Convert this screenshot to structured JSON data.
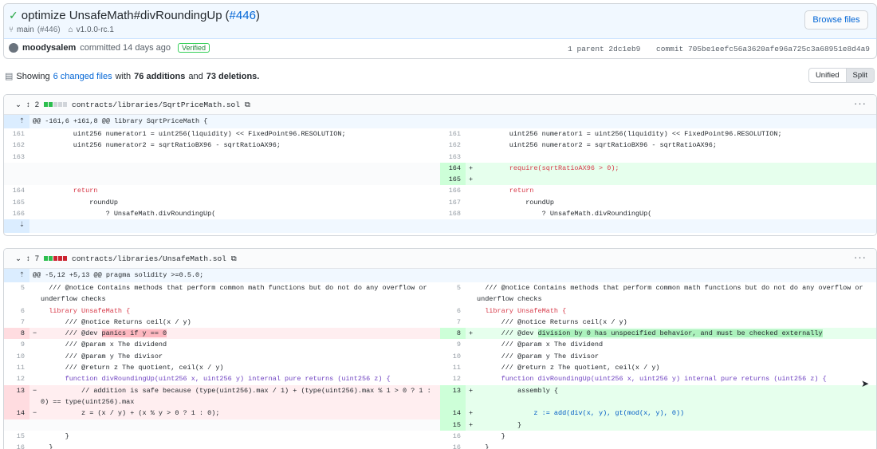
{
  "commit": {
    "title": "optimize UnsafeMath#divRoundingUp",
    "pr": "#446",
    "branch": "main",
    "branch_pr": "(#446)",
    "tag": "v1.0.0-rc.1",
    "browse_label": "Browse files",
    "author": "moodysalem",
    "committed": "committed 14 days ago",
    "verified": "Verified",
    "parent": "1 parent 2dc1eb9",
    "sha": "commit 705be1eefc56a3620afe96a725c3a68951e8d4a9"
  },
  "summary": {
    "prefix": "Showing",
    "files_link": "6 changed files",
    "middle": "with",
    "additions": "76 additions",
    "and": "and",
    "deletions": "73 deletions."
  },
  "view_toggle": {
    "unified": "Unified",
    "split": "Split"
  },
  "files": [
    {
      "count": "2",
      "path": "contracts/libraries/SqrtPriceMath.sol",
      "hunk": "@@ -161,6 +161,8 @@ library SqrtPriceMath {"
    },
    {
      "count": "7",
      "path": "contracts/libraries/UnsafeMath.sol",
      "hunk": "@@ -5,12 +5,13 @@ pragma solidity >=0.5.0;"
    }
  ],
  "f1": {
    "l161": "161",
    "l162": "162",
    "l163": "163",
    "l164": "164",
    "l165": "165",
    "l166": "166",
    "r161": "161",
    "r162": "162",
    "r163": "163",
    "r164": "164",
    "r165": "165",
    "r166": "166",
    "r167": "167",
    "r168": "168",
    "c161": "        uint256 numerator1 = uint256(liquidity) << FixedPoint96.RESOLUTION;",
    "c162": "        uint256 numerator2 = sqrtRatioBX96 - sqrtRatioAX96;",
    "add1": "        require(sqrtRatioAX96 > 0);",
    "ret": "        return",
    "round": "            roundUp",
    "tern": "                ? UnsafeMath.divRoundingUp("
  },
  "f2": {
    "l5": "5",
    "l6": "6",
    "l7": "7",
    "l8": "8",
    "l9": "9",
    "l10": "10",
    "l11": "11",
    "l12": "12",
    "l13": "13",
    "l14": "14",
    "l15": "15",
    "l16": "16",
    "r13": "13",
    "r14": "14",
    "r15": "15",
    "r16": "16",
    "notice": "  /// @notice Contains methods that perform common math functions but do not do any overflow or underflow checks",
    "lib": "  library UnsafeMath {",
    "ceil": "      /// @notice Returns ceil(x / y)",
    "dev_old_a": "      /// @dev ",
    "dev_old_hl": "panics if y == 0",
    "dev_new_a": "      /// @dev ",
    "dev_new_hl": "division by 0 has unspecified behavior, and must be checked externally",
    "px": "      /// @param x The dividend",
    "py": "      /// @param y The divisor",
    "ret": "      /// @return z The quotient, ceil(x / y)",
    "fn": "      function divRoundingUp(uint256 x, uint256 y) internal pure returns (uint256 z) {",
    "old13": "          // addition is safe because (type(uint256).max / 1) + (type(uint256).max % 1 > 0 ? 1 : 0) == type(uint256).max",
    "old14": "          z = (x / y) + (x % y > 0 ? 1 : 0);",
    "new13": "          assembly {",
    "new14": "              z := add(div(x, y), gt(mod(x, y), 0))",
    "new15": "          }",
    "close": "      }",
    "close2": "  }"
  }
}
